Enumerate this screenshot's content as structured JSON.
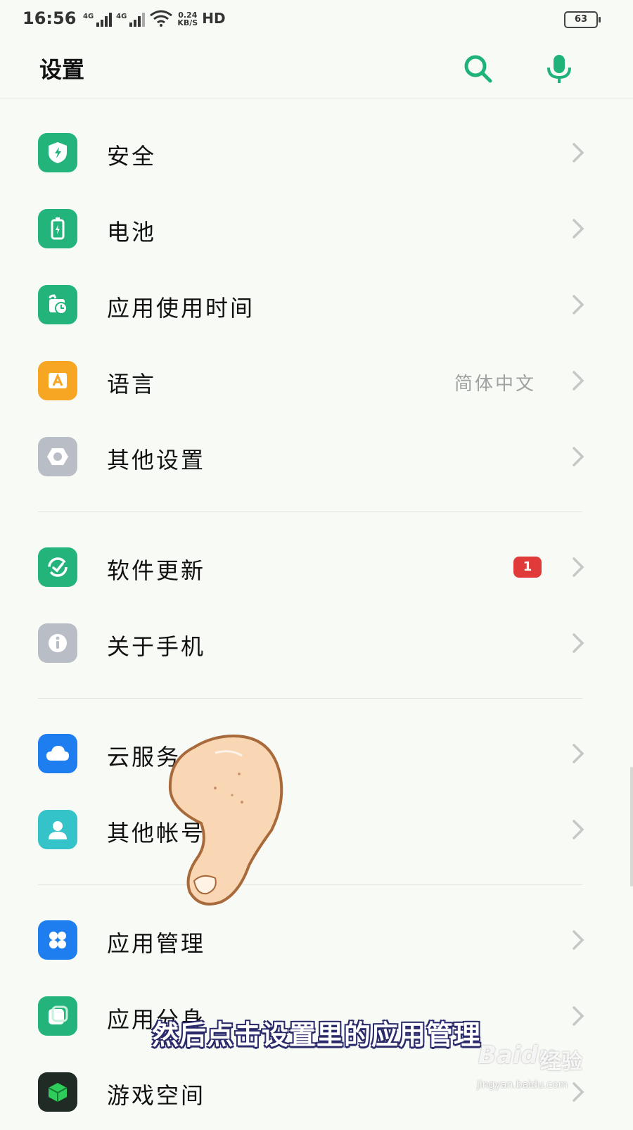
{
  "status": {
    "time": "16:56",
    "signal_1_label": "4G",
    "signal_2_label": "4G",
    "net_speed_value": "0.24",
    "net_speed_unit": "KB/S",
    "hd_label": "HD",
    "battery": "63"
  },
  "header": {
    "title": "设置",
    "search_icon": "search-icon",
    "voice_icon": "microphone-icon"
  },
  "accent_color": "#1fb37a",
  "sections": [
    {
      "items": [
        {
          "label": "安全",
          "icon": "shield-icon",
          "color": "#23b47c"
        },
        {
          "label": "电池",
          "icon": "battery-icon",
          "color": "#23b47c"
        },
        {
          "label": "应用使用时间",
          "icon": "usage-clock-icon",
          "color": "#23b47c"
        },
        {
          "label": "语言",
          "icon": "language-icon",
          "color": "#f6a623",
          "value": "简体中文"
        },
        {
          "label": "其他设置",
          "icon": "more-settings-icon",
          "color": "#b9bec6"
        }
      ]
    },
    {
      "items": [
        {
          "label": "软件更新",
          "icon": "update-icon",
          "color": "#23b47c",
          "badge": "1"
        },
        {
          "label": "关于手机",
          "icon": "info-icon",
          "color": "#b9bec6"
        }
      ]
    },
    {
      "items": [
        {
          "label": "云服务",
          "icon": "cloud-icon",
          "color": "#1e7ef0"
        },
        {
          "label": "其他帐号",
          "icon": "account-icon",
          "color": "#34c3c9"
        }
      ]
    },
    {
      "items": [
        {
          "label": "应用管理",
          "icon": "app-grid-icon",
          "color": "#1e7ef0"
        },
        {
          "label": "应用分身",
          "icon": "app-clone-icon",
          "color": "#23b47c"
        },
        {
          "label": "游戏空间",
          "icon": "game-cube-icon",
          "color": "#1f2b24"
        }
      ]
    }
  ],
  "caption": "然后点击设置里的应用管理",
  "watermark": {
    "brand": "Baidu",
    "cn": "经验",
    "url": "jingyan.baidu.com"
  }
}
